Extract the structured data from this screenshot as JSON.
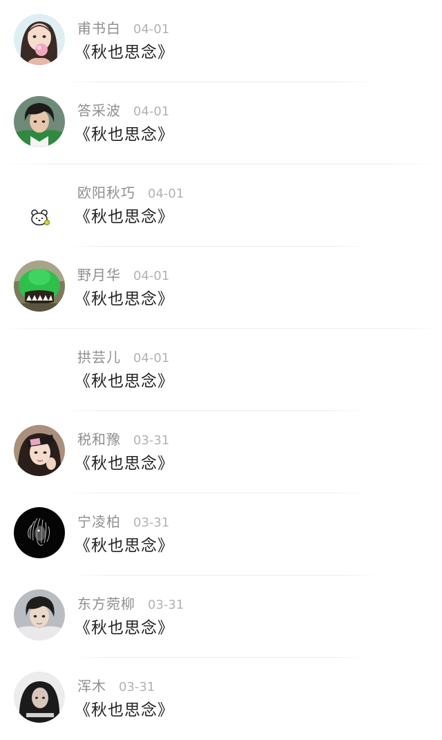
{
  "comments": [
    {
      "name": "甫书白",
      "date": "04-01",
      "title": "《秋也思念》",
      "avatar": "cartoon-girl-bubble-avatar"
    },
    {
      "name": "答采波",
      "date": "04-01",
      "title": "《秋也思念》",
      "avatar": "young-man-photo-avatar"
    },
    {
      "name": "欧阳秋巧",
      "date": "04-01",
      "title": "《秋也思念》",
      "avatar": "cartoon-bear-avatar"
    },
    {
      "name": "野月华",
      "date": "04-01",
      "title": "《秋也思念》",
      "avatar": "green-dinosaur-avatar"
    },
    {
      "name": "拱芸儿",
      "date": "04-01",
      "title": "《秋也思念》",
      "avatar": "blank-avatar"
    },
    {
      "name": "税和豫",
      "date": "03-31",
      "title": "《秋也思念》",
      "avatar": "girl-with-hat-avatar"
    },
    {
      "name": "宁凌柏",
      "date": "03-31",
      "title": "《秋也思念》",
      "avatar": "black-white-lion-avatar"
    },
    {
      "name": "东方菀柳",
      "date": "03-31",
      "title": "《秋也思念》",
      "avatar": "young-man-portrait-avatar"
    },
    {
      "name": "浑木",
      "date": "03-31",
      "title": "《秋也思念》",
      "avatar": "man-in-hoodie-avatar"
    }
  ]
}
